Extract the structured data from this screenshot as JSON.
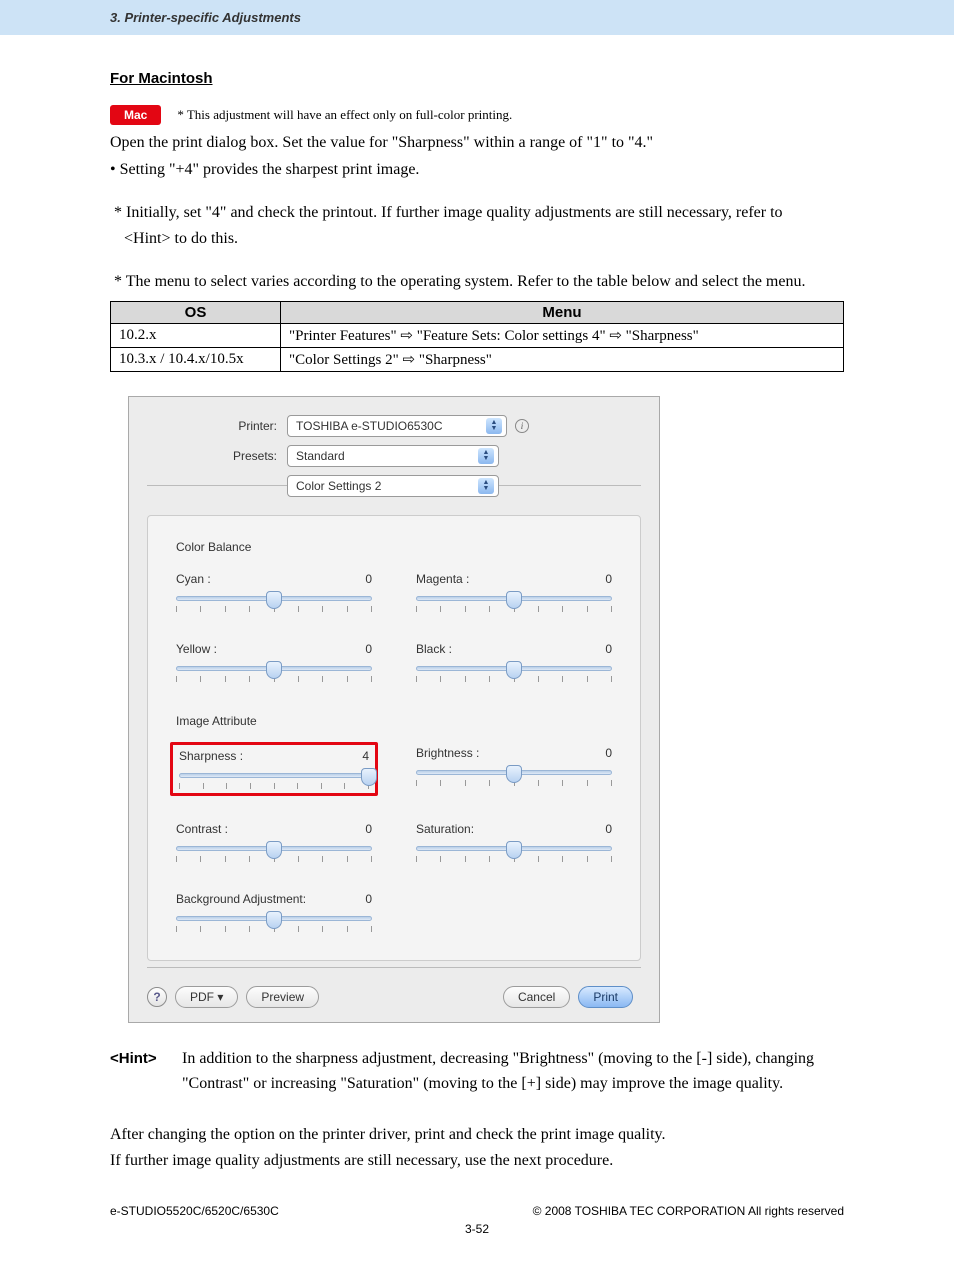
{
  "header": "3. Printer-specific Adjustments",
  "section_title": "For Macintosh",
  "mac_badge": "Mac",
  "mac_note": "* This adjustment will have an effect only on full-color printing.",
  "p1": "Open the print dialog box.  Set the value for \"Sharpness\" within a range of \"1\" to \"4.\"",
  "p2": "• Setting \"+4\" provides the sharpest print image.",
  "p3a": "* Initially, set \"4\" and check the printout.  If further image quality adjustments are still necessary, refer to",
  "p3b": "<Hint> to do this.",
  "p4": "* The menu to select varies according to the operating system.  Refer to the table below and select the menu.",
  "table": {
    "headers": [
      "OS",
      "Menu"
    ],
    "rows": [
      [
        "10.2.x",
        "\"Printer Features\" ⇨ \"Feature Sets: Color settings 4\" ⇨ \"Sharpness\""
      ],
      [
        "10.3.x / 10.4.x/10.5x",
        "\"Color Settings 2\" ⇨ \"Sharpness\""
      ]
    ]
  },
  "dialog": {
    "printer_label": "Printer:",
    "printer_value": "TOSHIBA e-STUDIO6530C",
    "presets_label": "Presets:",
    "presets_value": "Standard",
    "section_value": "Color Settings 2",
    "group1": "Color Balance",
    "group2": "Image Attribute",
    "sliders": {
      "cyan": {
        "label": "Cyan :",
        "value": "0",
        "pos": 50
      },
      "magenta": {
        "label": "Magenta :",
        "value": "0",
        "pos": 50
      },
      "yellow": {
        "label": "Yellow :",
        "value": "0",
        "pos": 50
      },
      "black": {
        "label": "Black :",
        "value": "0",
        "pos": 50
      },
      "sharpness": {
        "label": "Sharpness :",
        "value": "4",
        "pos": 100
      },
      "brightness": {
        "label": "Brightness :",
        "value": "0",
        "pos": 50
      },
      "contrast": {
        "label": "Contrast :",
        "value": "0",
        "pos": 50
      },
      "saturation": {
        "label": "Saturation:",
        "value": "0",
        "pos": 50
      },
      "background": {
        "label": "Background Adjustment:",
        "value": "0",
        "pos": 50
      }
    },
    "help": "?",
    "pdf": "PDF ▾",
    "preview": "Preview",
    "cancel": "Cancel",
    "print": "Print"
  },
  "hint_label": "<Hint>",
  "hint_body": "In addition to the sharpness adjustment, decreasing \"Brightness\" (moving to the [-] side), changing \"Contrast\" or increasing \"Saturation\" (moving to the [+] side) may improve the image quality.",
  "p5": "After changing the option on the printer driver, print and check the print image quality.",
  "p6": "If further image quality adjustments are still necessary, use the next procedure.",
  "footer_left": "e-STUDIO5520C/6520C/6530C",
  "footer_right": "© 2008 TOSHIBA TEC CORPORATION All rights reserved",
  "page_number": "3-52"
}
